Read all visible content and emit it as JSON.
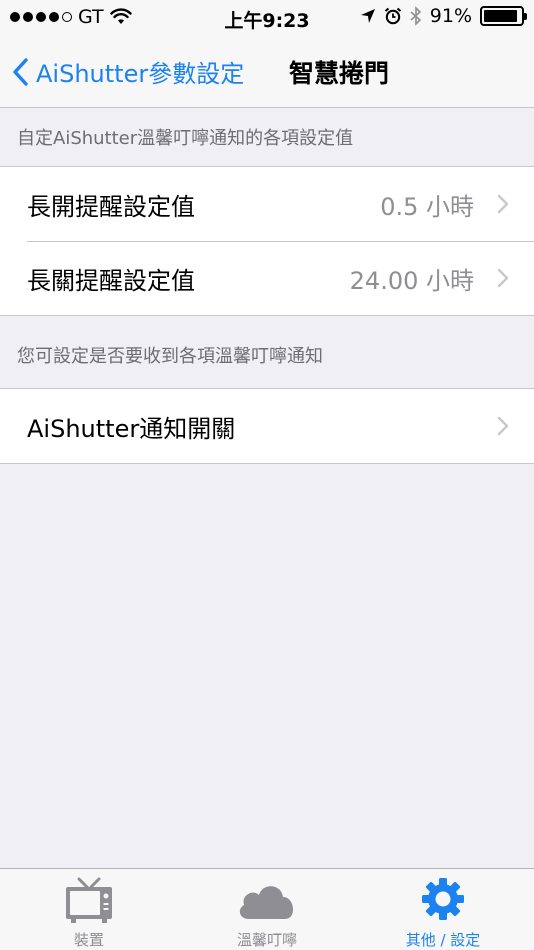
{
  "status_bar": {
    "carrier": "GT",
    "time": "上午9:23",
    "battery_percent": "91%",
    "battery_level": 0.91
  },
  "nav": {
    "back_label": "AiShutter參數設定",
    "title": "智慧捲門"
  },
  "section1": {
    "header": "自定AiShutter溫馨叮嚀通知的各項設定值",
    "rows": [
      {
        "label": "長開提醒設定值",
        "value": "0.5 小時"
      },
      {
        "label": "長關提醒設定值",
        "value": "24.00 小時"
      }
    ]
  },
  "section2": {
    "header": "您可設定是否要收到各項溫馨叮嚀通知",
    "rows": [
      {
        "label": "AiShutter通知開關"
      }
    ]
  },
  "tab_bar": {
    "tabs": [
      {
        "label": "裝置",
        "icon": "tv-icon",
        "active": false
      },
      {
        "label": "溫馨叮嚀",
        "icon": "cloud-icon",
        "active": false
      },
      {
        "label": "其他 / 設定",
        "icon": "gear-icon",
        "active": true
      }
    ]
  },
  "colors": {
    "accent": "#1b82f0",
    "background": "#efeff4",
    "secondary_text": "#8e8e93"
  }
}
